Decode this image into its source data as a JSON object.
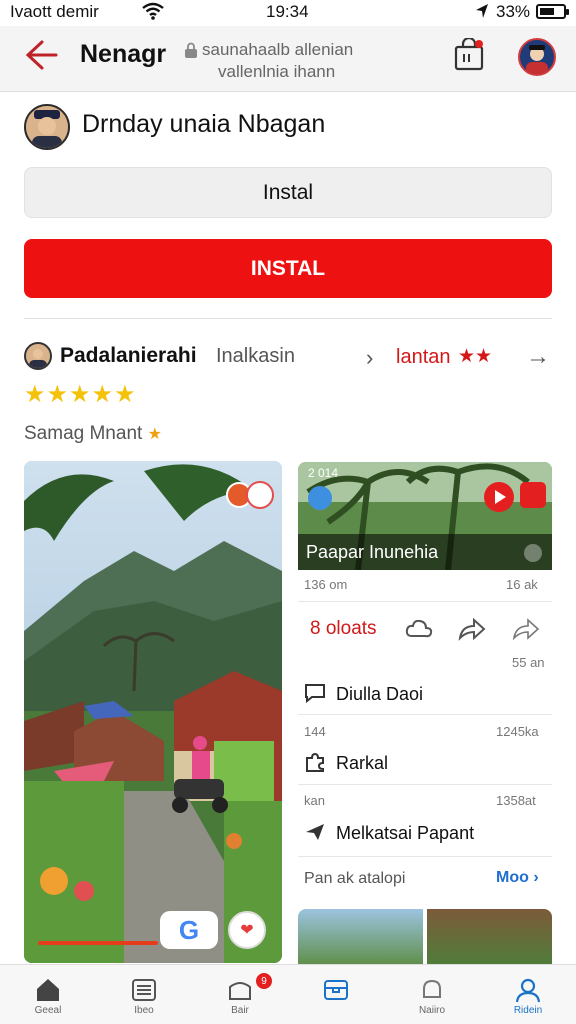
{
  "status_bar": {
    "carrier": "Ivaott demir",
    "time": "19:34",
    "battery_pct": "33%"
  },
  "header": {
    "title": "Nenagr",
    "subtitle_line1": "saunahaalb allenian",
    "subtitle_line2": "vallenlnia ihann"
  },
  "profile": {
    "name": "Drnday unaia Nbagan"
  },
  "buttons": {
    "install_secondary": "Instal",
    "install_primary": "INSTAL"
  },
  "channel": {
    "name": "Padalanierahi",
    "meta": "Inalkasin",
    "link": "lantan",
    "stars_small": "★★",
    "rating_stars": "★★★★★",
    "sub_label": "Samag Mnant"
  },
  "video_card": {
    "timestamp": "2 014",
    "title": "Paapar Inunehia",
    "date_left": "136 om",
    "date_right": "16 ak",
    "count": "8 oloats",
    "small_meta": "55 an"
  },
  "list": [
    {
      "label": "Diulla Daoi",
      "meta_left": "144",
      "meta_right": "1245ka"
    },
    {
      "label": "Rarkal",
      "meta_left": "kan",
      "meta_right": "1358at"
    },
    {
      "label": "Melkatsai Papant",
      "meta_left": "",
      "meta_right": ""
    }
  ],
  "more": {
    "left": "Pan ak atalopi",
    "link": "Moo"
  },
  "bottom_nav": [
    {
      "label": "Geeal",
      "icon": "home-icon"
    },
    {
      "label": "Ibeo",
      "icon": "list-icon"
    },
    {
      "label": "Bair",
      "icon": "shop-icon",
      "badge": "9"
    },
    {
      "label": "",
      "icon": "box-icon"
    },
    {
      "label": "Naiiro",
      "icon": "notifications-icon"
    },
    {
      "label": "Ridein",
      "icon": "profile-icon"
    }
  ],
  "colors": {
    "accent_red": "#ee1111",
    "link_blue": "#1f6fd0",
    "star_yellow": "#f5c20b"
  }
}
